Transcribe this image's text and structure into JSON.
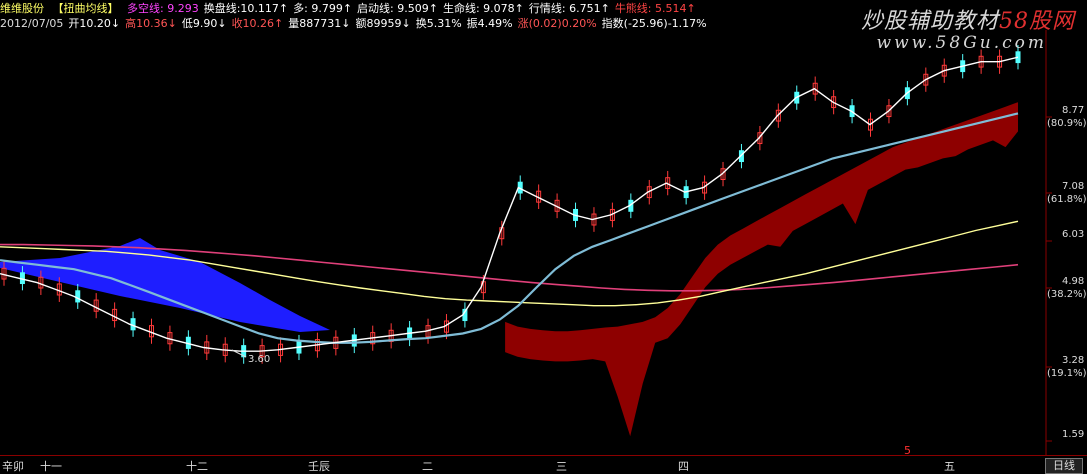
{
  "header_line1": {
    "stock_name": "维维股份",
    "indicator": "【扭曲均线】",
    "items": [
      {
        "text": "多空线: 9.293",
        "color": "#ff44ff"
      },
      {
        "text": "换盘线:10.117↑",
        "color": "#ffffff"
      },
      {
        "text": "多: 9.799↑",
        "color": "#ffffff"
      },
      {
        "text": "启动线: 9.509↑",
        "color": "#ffffff"
      },
      {
        "text": "生命线: 9.078↑",
        "color": "#ffffff"
      },
      {
        "text": "行情线: 6.751↑",
        "color": "#ffffff"
      },
      {
        "text": "牛熊线: 5.514↑",
        "color": "#ff4444"
      }
    ]
  },
  "header_line2": {
    "items": [
      {
        "text": "2012/07/05",
        "color": "#dddddd"
      },
      {
        "text": "开10.20↓",
        "color": "#ffffff"
      },
      {
        "text": "高10.36↓",
        "color": "#ff5555"
      },
      {
        "text": "低9.90↓",
        "color": "#ffffff"
      },
      {
        "text": "收10.26↑",
        "color": "#ff5555"
      },
      {
        "text": "量887731↓",
        "color": "#ffffff"
      },
      {
        "text": "额89959↓",
        "color": "#ffffff"
      },
      {
        "text": "换5.31%",
        "color": "#ffffff"
      },
      {
        "text": "振4.49%",
        "color": "#ffffff"
      },
      {
        "text": "涨(0.02)0.20%",
        "color": "#ff5555"
      },
      {
        "text": "指数(-25.96)-1.17%",
        "color": "#ffffff"
      }
    ]
  },
  "watermark": {
    "line1_a": "炒股辅助教材",
    "line1_b": "58股网",
    "line2": "www.58Gu.com"
  },
  "bottom": {
    "day_button": "日线",
    "red_marker": "5"
  },
  "colors": {
    "up_candle": "#ff3a3a",
    "down_candle": "#54ffff",
    "blue_band": "#1e1eff",
    "red_band": "#8e0000",
    "ma_white": "#ffffff",
    "ma_cyan": "#7fbcd6",
    "ma_yellow": "#ffff99",
    "ma_pink": "#e0407a"
  },
  "chart_data": {
    "type": "candlestick",
    "ylim": [
      1.59,
      10.5
    ],
    "y_ticks": [
      {
        "value": "8.77",
        "pct": "(80.9%)"
      },
      {
        "value": "7.08",
        "pct": "(61.8%)"
      },
      {
        "value": "6.03",
        "pct": ""
      },
      {
        "value": "4.98",
        "pct": "(38.2%)"
      },
      {
        "value": "3.28",
        "pct": "(19.1%)"
      },
      {
        "value": "1.59",
        "pct": ""
      }
    ],
    "x_labels": [
      "辛卯",
      "十一",
      "十二",
      "壬辰",
      "二",
      "三",
      "四",
      "五"
    ],
    "min_annotation": "3.60",
    "series_white_ma": [
      5.3,
      5.2,
      5.1,
      4.95,
      4.8,
      4.6,
      4.4,
      4.2,
      4.05,
      3.9,
      3.8,
      3.7,
      3.65,
      3.62,
      3.62,
      3.65,
      3.7,
      3.75,
      3.8,
      3.85,
      3.9,
      3.95,
      4.0,
      4.05,
      4.15,
      4.4,
      5.0,
      6.2,
      7.2,
      7.0,
      6.8,
      6.6,
      6.5,
      6.6,
      6.8,
      7.1,
      7.3,
      7.1,
      7.2,
      7.5,
      7.9,
      8.3,
      8.8,
      9.2,
      9.4,
      9.1,
      8.9,
      8.6,
      8.9,
      9.3,
      9.6,
      9.8,
      9.9,
      10.0,
      10.0,
      10.1
    ],
    "series_cyan_ma": [
      5.6,
      5.55,
      5.5,
      5.45,
      5.4,
      5.3,
      5.2,
      5.05,
      4.9,
      4.75,
      4.6,
      4.45,
      4.3,
      4.15,
      4.0,
      3.9,
      3.85,
      3.82,
      3.8,
      3.8,
      3.82,
      3.85,
      3.88,
      3.9,
      3.95,
      4.0,
      4.1,
      4.3,
      4.6,
      5.0,
      5.4,
      5.7,
      5.9,
      6.05,
      6.2,
      6.35,
      6.5,
      6.65,
      6.8,
      6.95,
      7.1,
      7.25,
      7.4,
      7.55,
      7.7,
      7.85,
      7.95,
      8.05,
      8.15,
      8.25,
      8.35,
      8.45,
      8.55,
      8.65,
      8.75,
      8.85
    ],
    "series_yellow_ma": [
      5.9,
      5.88,
      5.86,
      5.84,
      5.82,
      5.8,
      5.76,
      5.72,
      5.66,
      5.6,
      5.52,
      5.44,
      5.36,
      5.28,
      5.2,
      5.12,
      5.05,
      4.98,
      4.92,
      4.86,
      4.8,
      4.75,
      4.72,
      4.7,
      4.68,
      4.66,
      4.64,
      4.62,
      4.6,
      4.6,
      4.62,
      4.66,
      4.72,
      4.8,
      4.9,
      5.0,
      5.1,
      5.2,
      5.3,
      5.42,
      5.54,
      5.66,
      5.78,
      5.9,
      6.02,
      6.14,
      6.26,
      6.36,
      6.46
    ],
    "series_pink_ma": [
      5.95,
      5.95,
      5.94,
      5.93,
      5.92,
      5.9,
      5.88,
      5.85,
      5.82,
      5.78,
      5.74,
      5.7,
      5.65,
      5.6,
      5.55,
      5.5,
      5.45,
      5.4,
      5.35,
      5.3,
      5.25,
      5.2,
      5.15,
      5.1,
      5.06,
      5.02,
      4.98,
      4.95,
      4.93,
      4.92,
      4.92,
      4.93,
      4.95,
      4.98,
      5.02,
      5.06,
      5.1,
      5.15,
      5.2,
      5.25,
      5.3,
      5.35,
      5.4,
      5.45,
      5.5
    ]
  }
}
